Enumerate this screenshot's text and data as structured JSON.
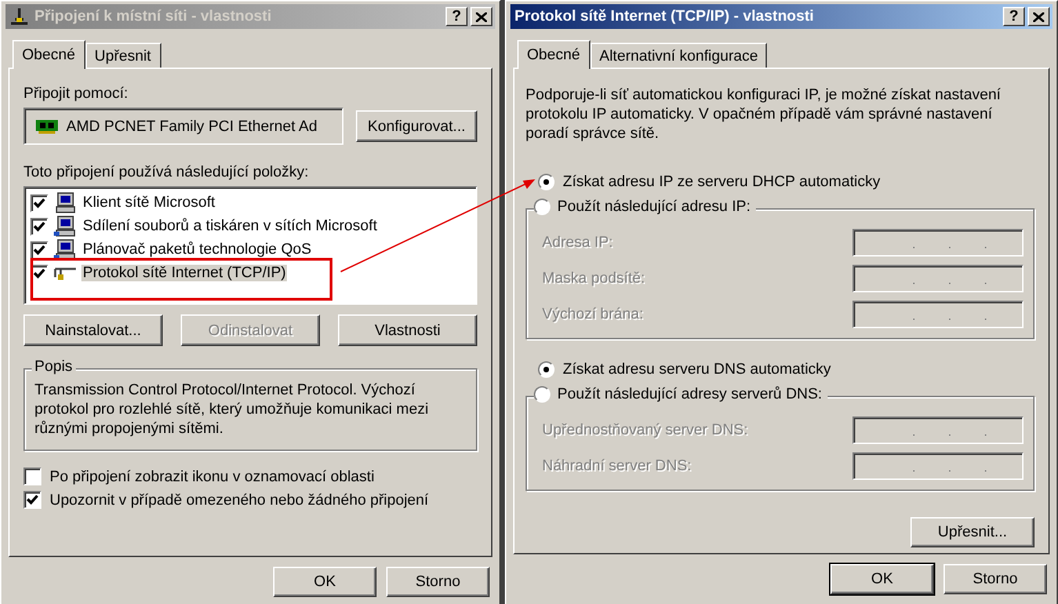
{
  "connection_dialog": {
    "title": "Připojení k místní síti - vlastnosti",
    "active": false,
    "help_button": "?",
    "tabs": [
      {
        "label": "Obecné",
        "selected": true
      },
      {
        "label": "Upřesnit",
        "selected": false
      }
    ],
    "connect_using_label": "Připojit pomocí:",
    "adapter": "AMD PCNET Family PCI Ethernet Ad",
    "configure_button": "Konfigurovat...",
    "components_label": "Toto připojení používá následující položky:",
    "components": [
      {
        "label": "Klient sítě Microsoft",
        "checked": true,
        "selected": false,
        "kind": "client"
      },
      {
        "label": "Sdílení souborů a tiskáren v sítích Microsoft",
        "checked": true,
        "selected": false,
        "kind": "service"
      },
      {
        "label": "Plánovač paketů technologie QoS",
        "checked": true,
        "selected": false,
        "kind": "service"
      },
      {
        "label": "Protokol sítě Internet (TCP/IP)",
        "checked": true,
        "selected": true,
        "kind": "protocol"
      }
    ],
    "component_buttons": [
      {
        "label": "Nainstalovat...",
        "disabled": false
      },
      {
        "label": "Odinstalovat",
        "disabled": true
      },
      {
        "label": "Vlastnosti",
        "disabled": false
      }
    ],
    "description": {
      "title": "Popis",
      "text": "Transmission Control Protocol/Internet Protocol. Výchozí protokol pro rozlehlé sítě, který umožňuje komunikaci mezi různými propojenými sítěmi."
    },
    "options": [
      {
        "label": "Po připojení zobrazit ikonu v oznamovací oblasti",
        "checked": false
      },
      {
        "label": "Upozornit v případě omezeného nebo žádného připojení",
        "checked": true
      }
    ],
    "footer_buttons": [
      {
        "label": "OK",
        "default": false
      },
      {
        "label": "Storno",
        "default": false
      }
    ]
  },
  "tcpip_dialog": {
    "title": "Protokol sítě Internet (TCP/IP) - vlastnosti",
    "active": true,
    "help_button": "?",
    "tabs": [
      {
        "label": "Obecné",
        "selected": true
      },
      {
        "label": "Alternativní konfigurace",
        "selected": false
      }
    ],
    "intro": "Podporuje-li síť automatickou konfiguraci IP, je možné získat nastavení protokolu IP automaticky. V opačném případě vám správné nastavení poradí správce sítě.",
    "ip_options": [
      {
        "kind": "radio",
        "label": "Získat adresu IP ze serveru DHCP automaticky",
        "selected": true
      },
      {
        "kind": "group",
        "label": "Použít následující adresu IP:",
        "selected": false,
        "fields": [
          {
            "label": "Adresa IP:",
            "disabled": true
          },
          {
            "label": "Maska podsítě:",
            "disabled": true
          },
          {
            "label": "Výchozí brána:",
            "disabled": true
          }
        ]
      }
    ],
    "dns_options": [
      {
        "kind": "radio",
        "label": "Získat adresu serveru DNS automaticky",
        "selected": true
      },
      {
        "kind": "group",
        "label": "Použít následující adresy serverů DNS:",
        "selected": false,
        "fields": [
          {
            "label": "Upřednostňovaný server DNS:",
            "disabled": true
          },
          {
            "label": "Náhradní server DNS:",
            "disabled": true
          }
        ]
      }
    ],
    "advanced_button": "Upřesnit...",
    "footer_buttons": [
      {
        "label": "OK",
        "default": true
      },
      {
        "label": "Storno",
        "default": false
      }
    ]
  }
}
